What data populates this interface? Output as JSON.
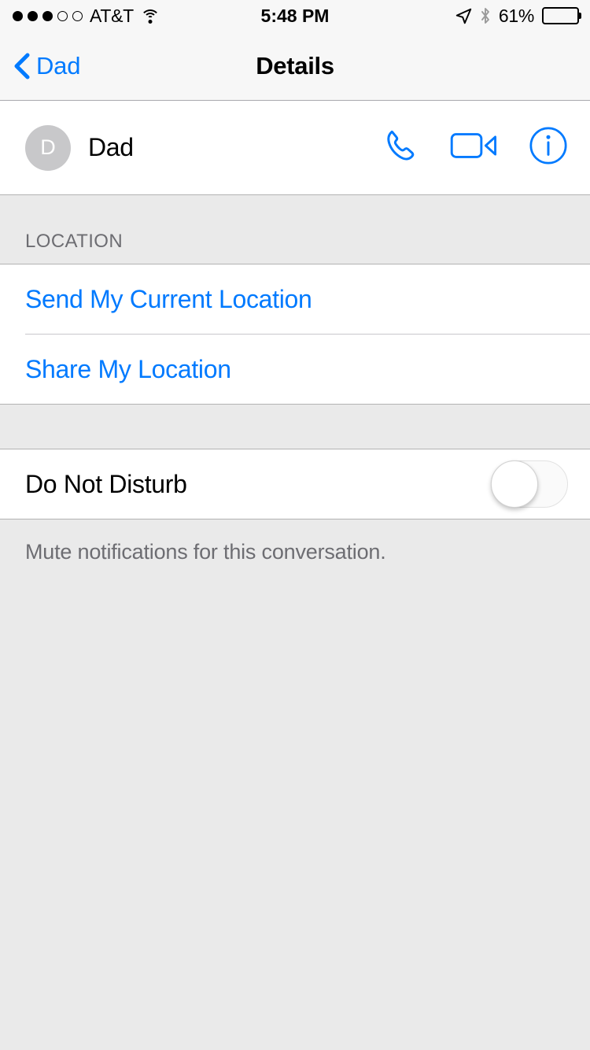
{
  "status_bar": {
    "signal_dots_filled": 3,
    "signal_dots_total": 5,
    "carrier": "AT&T",
    "wifi_icon": "wifi-icon",
    "time": "5:48 PM",
    "location_icon": "location-arrow-icon",
    "bluetooth_icon": "bluetooth-icon",
    "battery_percent_label": "61%",
    "battery_level": 61
  },
  "nav_bar": {
    "back_label": "Dad",
    "back_icon": "chevron-left-icon",
    "title": "Details"
  },
  "contact": {
    "avatar_initial": "D",
    "name": "Dad",
    "actions": [
      {
        "name": "call-button",
        "icon": "phone-icon"
      },
      {
        "name": "facetime-button",
        "icon": "video-camera-icon"
      },
      {
        "name": "info-button",
        "icon": "info-circle-icon"
      }
    ]
  },
  "location_section": {
    "header": "LOCATION",
    "rows": [
      {
        "label": "Send My Current Location"
      },
      {
        "label": "Share My Location"
      }
    ]
  },
  "dnd_section": {
    "label": "Do Not Disturb",
    "toggle_on": false,
    "footnote": "Mute notifications for this conversation."
  },
  "colors": {
    "accent_blue": "#007AFF",
    "group_background": "#eaeaea",
    "row_background": "#ffffff",
    "bar_background": "#f7f7f7",
    "secondary_text": "#6d6d72",
    "avatar_gray": "#c8c8ca"
  }
}
